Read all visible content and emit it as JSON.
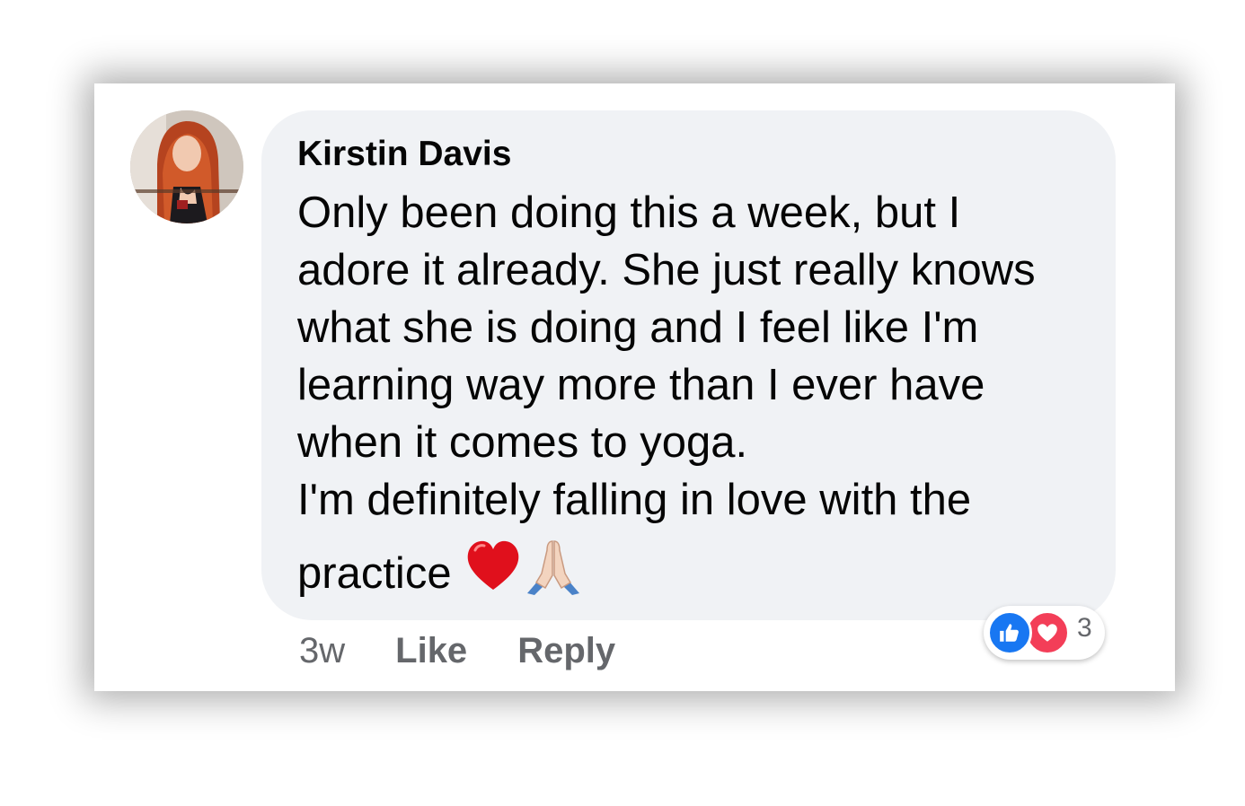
{
  "comment": {
    "author": "Kirstin Davis",
    "lines": [
      "Only been doing this a week, but I",
      "adore it already. She just really knows",
      "what she is doing and I feel like I'm",
      "learning way more than I ever have",
      "when it comes to yoga.",
      "I'm definitely falling in love with the",
      "practice"
    ],
    "emojis": [
      "red-heart-icon",
      "folded-hands-icon"
    ],
    "timestamp": "3w",
    "like_label": "Like",
    "reply_label": "Reply",
    "reactions": {
      "icons": [
        "like-icon",
        "love-icon"
      ],
      "count": "3",
      "like_color": "#1877f2",
      "love_color": "#f33e58"
    }
  },
  "colors": {
    "bubble": "#f0f2f5",
    "text": "#050505",
    "secondary_text": "#65676b"
  }
}
